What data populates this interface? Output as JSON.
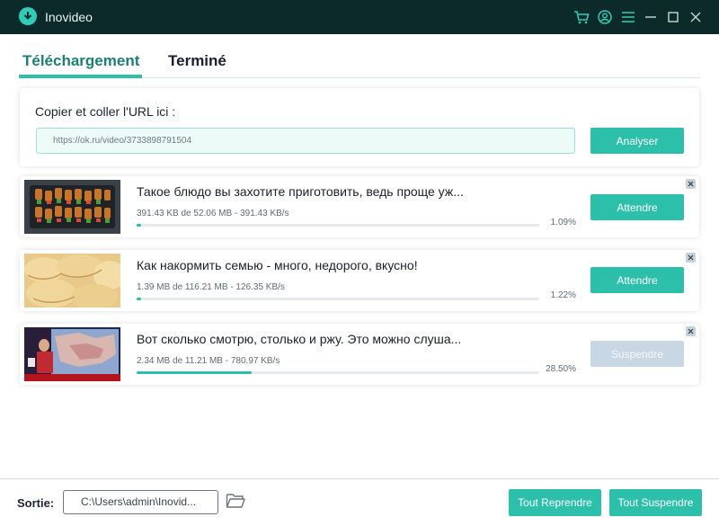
{
  "app": {
    "title": "Inovideo"
  },
  "titlebar": {
    "icons": [
      "cart-icon",
      "account-icon",
      "menu-icon",
      "minimize-icon",
      "maximize-icon",
      "close-icon"
    ]
  },
  "tabs": [
    {
      "label": "Téléchargement",
      "active": true
    },
    {
      "label": "Terminé",
      "active": false
    }
  ],
  "url_box": {
    "label": "Copier et coller l'URL ici :",
    "value": "https://ok.ru/video/3733898791504",
    "analyze_label": "Analyser"
  },
  "downloads": [
    {
      "title": "Такое блюдо вы захотите приготовить, ведь проще уж...",
      "info": "391.43 KB de 52.06 MB - 391.43 KB/s",
      "percent": "1.09%",
      "progress": 0.0109,
      "action_label": "Attendre",
      "action_enabled": true
    },
    {
      "title": "Как накормить семью - много, недорого, вкусно!",
      "info": "1.39 MB de 116.21 MB - 126.35 KB/s",
      "percent": "1.22%",
      "progress": 0.0122,
      "action_label": "Attendre",
      "action_enabled": true
    },
    {
      "title": "Вот сколько смотрю, столько и ржу. Это можно слуша...",
      "info": "2.34 MB de 11.21 MB - 780.97 KB/s",
      "percent": "28.50%",
      "progress": 0.285,
      "action_label": "Suspendre",
      "action_enabled": false
    }
  ],
  "footer": {
    "output_label": "Sortie:",
    "output_path": "C:\\Users\\admin\\Inovid...",
    "resume_all_label": "Tout Reprendre",
    "suspend_all_label": "Tout Suspendre"
  },
  "colors": {
    "accent": "#2cbfaa",
    "titlebar": "#0c2a2a",
    "disabled": "#c9d6e3"
  }
}
